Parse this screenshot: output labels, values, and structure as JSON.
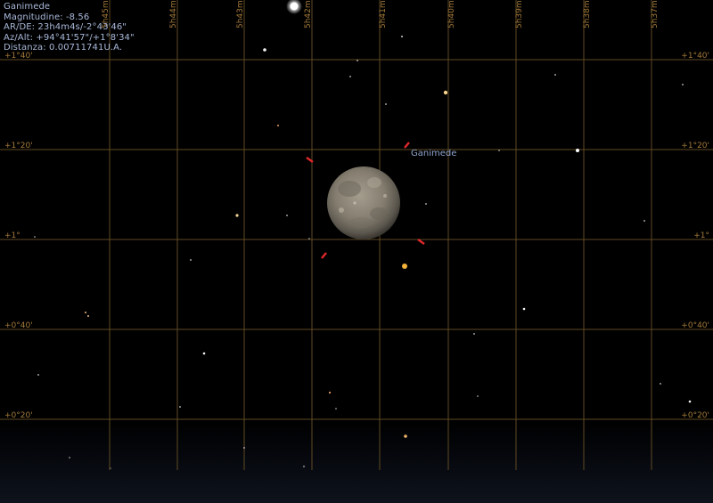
{
  "info": {
    "object_name": "Ganimede",
    "magnitude": "Magnitudine: -8.56",
    "ra_dec": "AR/DE: 23h4m4s/-2°43'46\"",
    "az_alt": "Az/Alt: +94°41'57\"/+1°8'34\"",
    "distance": "Distanza: 0.00711741U.A."
  },
  "grid": {
    "ra_labels": [
      "5h45m",
      "5h44m",
      "5h43m",
      "5h42m",
      "5h41m",
      "5h40m",
      "5h39m",
      "5h38m",
      "5h37m"
    ],
    "dec_labels": [
      "+1°40'",
      "+1°20'",
      "+1°",
      "+0°40'",
      "+0°20'"
    ]
  },
  "target": {
    "label": "Ganimede"
  },
  "colors": {
    "grid": "#5f4a23",
    "grid_label": "#a37a3a",
    "info_text": "#a9b9da",
    "target_label": "#8fa4cf",
    "pointer_marks": "#e0282a"
  }
}
